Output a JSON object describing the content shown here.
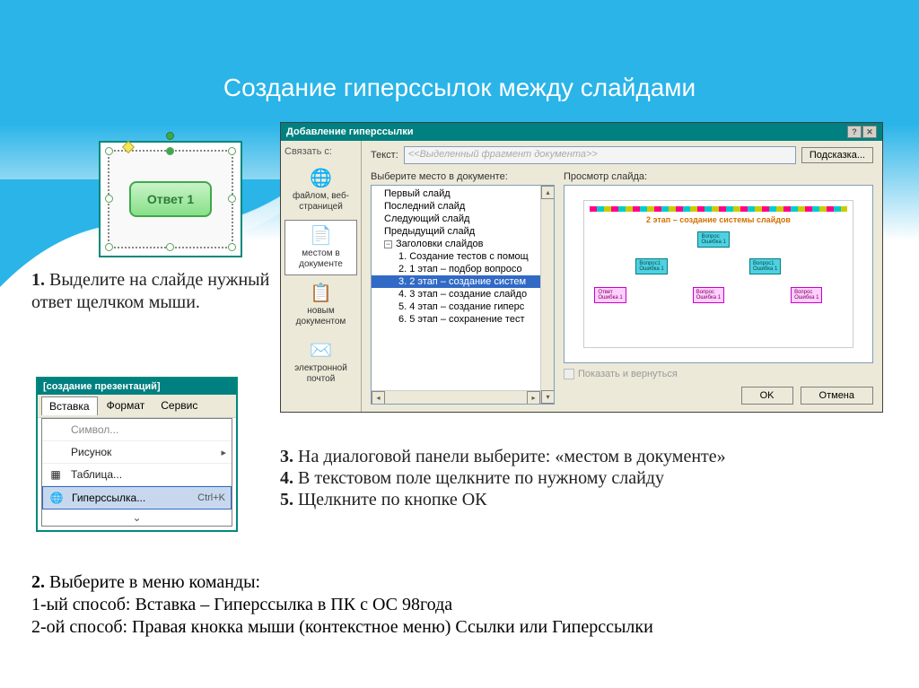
{
  "title": "Создание гиперссылок между слайдами",
  "answer_button": "Ответ 1",
  "step1": {
    "num": "1.",
    "text": " Выделите на слайде нужный ответ щелчком мыши."
  },
  "menu": {
    "window_title": "[создание презентаций]",
    "items_bar": [
      "Вставка",
      "Формат",
      "Сервис"
    ],
    "dd": {
      "symbol": "Символ...",
      "picture": "Рисунок",
      "table": "Таблица...",
      "hyperlink": "Гиперссылка...",
      "shortcut": "Ctrl+K"
    }
  },
  "instr3": {
    "l1a": "3.",
    "l1b": " На диалоговой панели выберите: «местом в документе»",
    "l2a": "4.",
    "l2b": " В текстовом поле щелкните по нужному слайду",
    "l3a": "5.",
    "l3b": " Щелкните по кнопке ОК"
  },
  "step2": {
    "l1a": "2.",
    "l1b": " Выберите в меню команды:",
    "l2": "1-ый способ: Вставка – Гиперссылка в ПК с ОС 98года",
    "l3": "2-ой способ: Правая кнокка мыши (контекстное меню) Ссылки или Гиперссылки"
  },
  "dialog": {
    "title": "Добавление гиперссылки",
    "link_label": "Связать с:",
    "text_label": "Текст:",
    "text_value": "<<Выделенный фрагмент документа>>",
    "hint_btn": "Подсказка...",
    "sidebar": {
      "file": "файлом, веб-страницей",
      "place": "местом в документе",
      "newdoc": "новым документом",
      "email": "электронной почтой"
    },
    "col_left_label": "Выберите место в документе:",
    "col_right_label": "Просмотр слайда:",
    "tree": [
      "Первый слайд",
      "Последний слайд",
      "Следующий слайд",
      "Предыдущий слайд",
      "Заголовки слайдов",
      "1. Создание тестов с помощ",
      "2. 1 этап – подбор вопросо",
      "3. 2 этап – создание систем",
      "4. 3 этап – создание слайдо",
      "5. 4 этап – создание гиперс",
      "6. 5 этап – сохранение тест"
    ],
    "preview_title": "2 этап – создание системы слайдов",
    "show_return": "Показать и вернуться",
    "ok": "OK",
    "cancel": "Отмена"
  }
}
